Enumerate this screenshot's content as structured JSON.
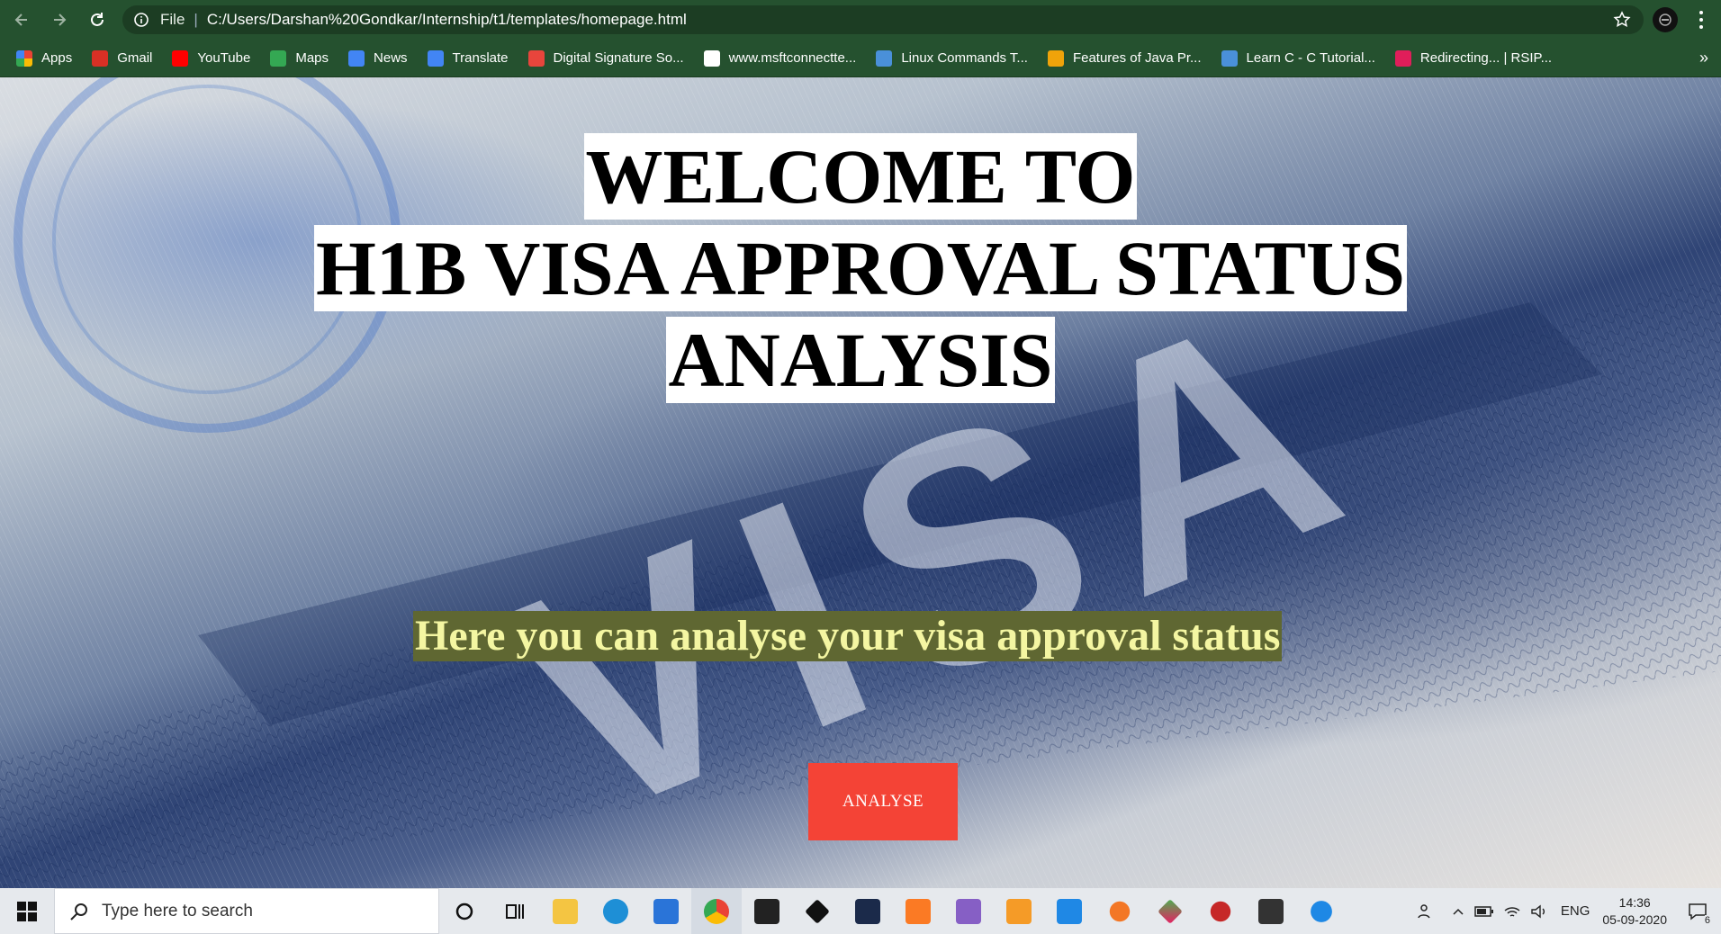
{
  "browser": {
    "file_label": "File",
    "url": "C:/Users/Darshan%20Gondkar/Internship/t1/templates/homepage.html"
  },
  "bookmarks": [
    {
      "label": "Apps",
      "icon": "apps-grid-icon",
      "color": "#e94235"
    },
    {
      "label": "Gmail",
      "icon": "gmail-icon",
      "color": "#d93025"
    },
    {
      "label": "YouTube",
      "icon": "youtube-icon",
      "color": "#ff0000"
    },
    {
      "label": "Maps",
      "icon": "maps-pin-icon",
      "color": "#34a853"
    },
    {
      "label": "News",
      "icon": "news-icon",
      "color": "#4285f4"
    },
    {
      "label": "Translate",
      "icon": "translate-icon",
      "color": "#4285f4"
    },
    {
      "label": "Digital Signature So...",
      "icon": "signature-icon",
      "color": "#e8453c"
    },
    {
      "label": "www.msftconnectte...",
      "icon": "msft-icon",
      "color": "#ffffff"
    },
    {
      "label": "Linux Commands T...",
      "icon": "site-icon",
      "color": "#4a90d9"
    },
    {
      "label": "Features of Java Pr...",
      "icon": "java-icon",
      "color": "#f0a30a"
    },
    {
      "label": "Learn C - C Tutorial...",
      "icon": "site-icon",
      "color": "#4a90d9"
    },
    {
      "label": "Redirecting... | RSIP...",
      "icon": "slack-icon",
      "color": "#e01e5a"
    }
  ],
  "page": {
    "title_lines": [
      "WELCOME TO",
      "H1B VISA APPROVAL STATUS",
      "ANALYSIS"
    ],
    "subtitle": "Here you can analyse your visa approval status",
    "button_label": "ANALYSE",
    "button_color": "#f44336",
    "subtitle_bg": "#5f6732",
    "subtitle_color": "#f4f6a2"
  },
  "taskbar": {
    "search_placeholder": "Type here to search",
    "language": "ENG",
    "time": "14:36",
    "date": "05-09-2020",
    "notification_count": "6"
  }
}
